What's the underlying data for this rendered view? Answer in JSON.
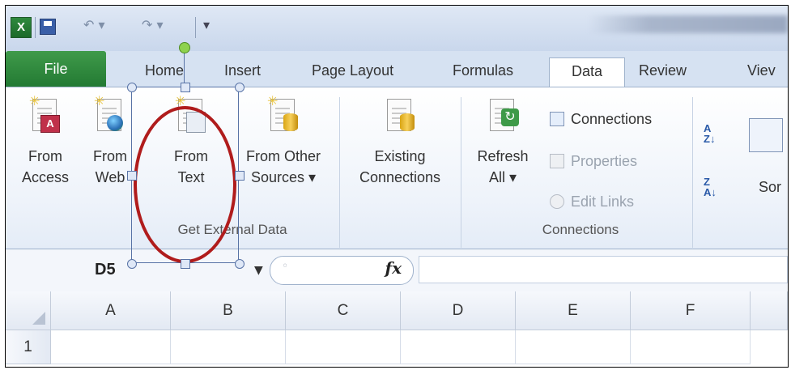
{
  "app": {
    "logo_letter": "X"
  },
  "qat": {
    "undo_glyph": "↶ ▾",
    "redo_glyph": "↷ ▾",
    "customize_glyph": "▾"
  },
  "tabs": [
    "File",
    "Home",
    "Insert",
    "Page Layout",
    "Formulas",
    "Data",
    "Review",
    "Viev"
  ],
  "active_tab": "Data",
  "ribbon": {
    "get_external_data": {
      "label": "Get External Data",
      "buttons": [
        {
          "line1": "From",
          "line2": "Access",
          "icon": "access-database-icon"
        },
        {
          "line1": "From",
          "line2": "Web",
          "icon": "web-globe-icon"
        },
        {
          "line1": "From",
          "line2": "Text",
          "icon": "text-file-icon"
        },
        {
          "line1": "From Other",
          "line2": "Sources ▾",
          "icon": "database-cylinder-icon"
        },
        {
          "line1": "Existing",
          "line2": "Connections",
          "icon": "connections-document-icon"
        }
      ]
    },
    "connections": {
      "label": "Connections",
      "refresh": {
        "line1": "Refresh",
        "line2": "All ▾"
      },
      "connections_label": "Connections",
      "properties_label": "Properties",
      "edit_links_label": "Edit Links"
    },
    "sort": {
      "sort_label": "Sor"
    }
  },
  "formula_bar": {
    "name_box": "D5",
    "name_box_arrow": "▼",
    "fx": "fx",
    "cancel": "◦",
    "value": ""
  },
  "sheet": {
    "columns": [
      "A",
      "B",
      "C",
      "D",
      "E",
      "F"
    ],
    "rows": [
      "1"
    ]
  },
  "colors": {
    "file_tab": "#2f8a3e",
    "annotation_oval": "#b01c1c",
    "ribbon_border": "#9fb2cc"
  }
}
